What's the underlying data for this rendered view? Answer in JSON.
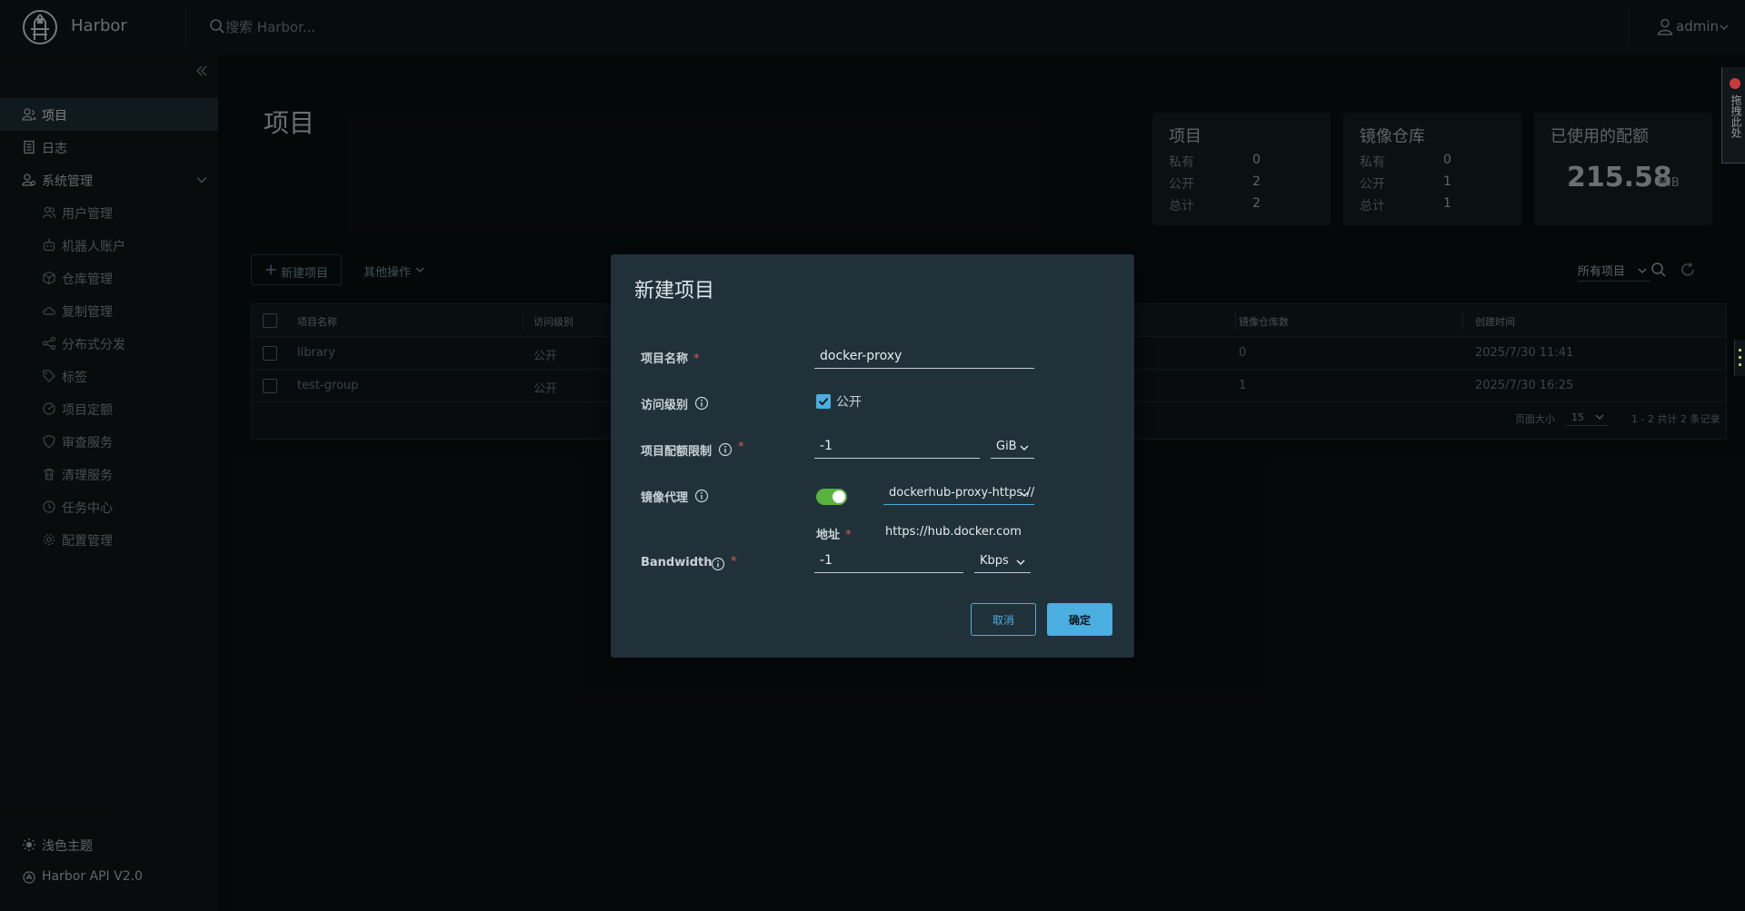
{
  "header": {
    "app_name": "Harbor",
    "search_placeholder": "搜索 Harbor...",
    "user": "admin"
  },
  "sidebar": {
    "items": [
      {
        "label": "项目",
        "icon": "projects-icon",
        "active": true
      },
      {
        "label": "日志",
        "icon": "logs-icon"
      },
      {
        "label": "系统管理",
        "icon": "admin-icon",
        "expanded": true
      },
      {
        "label": "用户管理",
        "icon": "users-icon",
        "sub": true
      },
      {
        "label": "机器人账户",
        "icon": "robot-icon",
        "sub": true
      },
      {
        "label": "仓库管理",
        "icon": "registry-icon",
        "sub": true
      },
      {
        "label": "复制管理",
        "icon": "replication-icon",
        "sub": true
      },
      {
        "label": "分布式分发",
        "icon": "distribution-icon",
        "sub": true
      },
      {
        "label": "标签",
        "icon": "tag-icon",
        "sub": true
      },
      {
        "label": "项目定额",
        "icon": "quota-icon",
        "sub": true
      },
      {
        "label": "审查服务",
        "icon": "shield-icon",
        "sub": true
      },
      {
        "label": "清理服务",
        "icon": "trash-icon",
        "sub": true
      },
      {
        "label": "任务中心",
        "icon": "clock-icon",
        "sub": true
      },
      {
        "label": "配置管理",
        "icon": "gear-icon",
        "sub": true
      }
    ],
    "bottom": {
      "theme": "浅色主题",
      "api": "Harbor API V2.0"
    }
  },
  "page": {
    "title": "项目"
  },
  "cards": {
    "projects": {
      "title": "项目",
      "rows": [
        {
          "label": "私有",
          "value": "0"
        },
        {
          "label": "公开",
          "value": "2"
        },
        {
          "label": "总计",
          "value": "2"
        }
      ]
    },
    "repos": {
      "title": "镜像仓库",
      "rows": [
        {
          "label": "私有",
          "value": "0"
        },
        {
          "label": "公开",
          "value": "1"
        },
        {
          "label": "总计",
          "value": "1"
        }
      ]
    },
    "quota": {
      "title": "已使用的配额",
      "value": "215.58",
      "unit": "MiB"
    }
  },
  "toolbar": {
    "new_project": "新建项目",
    "other_ops": "其他操作",
    "filter": "所有项目"
  },
  "table": {
    "headers": {
      "name": "项目名称",
      "access": "访问级别",
      "repos": "镜像仓库数",
      "created": "创建时间"
    },
    "rows": [
      {
        "name": "library",
        "access": "公开",
        "repos": "0",
        "created": "2025/7/30 11:41"
      },
      {
        "name": "test-group",
        "access": "公开",
        "repos": "1",
        "created": "2025/7/30 16:25"
      }
    ],
    "footer": {
      "page_size_label": "页面大小",
      "page_size": "15",
      "summary": "1 - 2 共计 2 条记录"
    }
  },
  "right_panel": {
    "text": "拖拽此处"
  },
  "modal": {
    "title": "新建项目",
    "name_label": "项目名称",
    "name_value": "docker-proxy",
    "access_label": "访问级别",
    "public_label": "公开",
    "public_checked": true,
    "quota_label": "项目配额限制",
    "quota_value": "-1",
    "quota_unit": "GiB",
    "proxy_label": "镜像代理",
    "proxy_enabled": true,
    "proxy_value": "dockerhub-proxy-https://hub.docker.com",
    "address_label": "地址",
    "address_value": "https://hub.docker.com",
    "bandwidth_label": "Bandwidth",
    "bandwidth_value": "-1",
    "bandwidth_unit": "Kbps",
    "required_mark": "*",
    "cancel": "取消",
    "ok": "确定"
  },
  "colors": {
    "accent": "#4aaee0",
    "toggle_on": "#57b33c",
    "required": "#e05a4f",
    "modal_bg": "#21313a"
  }
}
